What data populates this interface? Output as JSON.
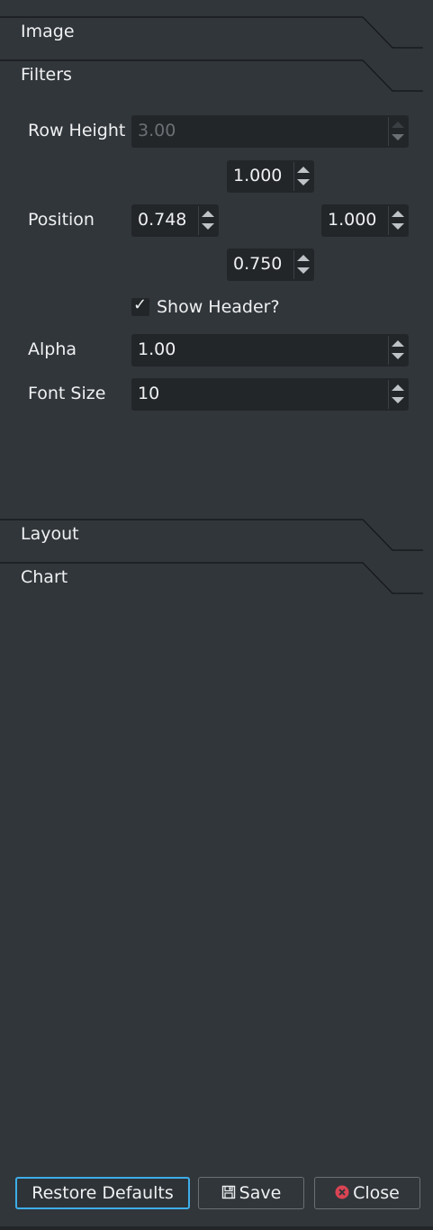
{
  "sections": {
    "image": {
      "label": "Image"
    },
    "filters": {
      "label": "Filters"
    },
    "layout": {
      "label": "Layout"
    },
    "chart": {
      "label": "Chart"
    }
  },
  "filters": {
    "row_height": {
      "label": "Row Height",
      "value": "3.00",
      "enabled": false
    },
    "position": {
      "label": "Position",
      "top": "1.000",
      "left": "0.748",
      "right": "1.000",
      "bottom": "0.750"
    },
    "show_header": {
      "label": "Show Header?",
      "checked": true
    },
    "alpha": {
      "label": "Alpha",
      "value": "1.00"
    },
    "font_size": {
      "label": "Font Size",
      "value": "10"
    }
  },
  "buttons": {
    "restore_defaults": "Restore Defaults",
    "save": "Save",
    "close": "Close"
  },
  "colors": {
    "background": "#31363b",
    "input_background": "#232629",
    "text": "#eff0f1",
    "focus_accent": "#3daee9",
    "close_icon": "#da4453"
  },
  "icons": [
    "save-icon",
    "close-icon",
    "spin-up-icon",
    "spin-down-icon",
    "checkmark-icon"
  ]
}
